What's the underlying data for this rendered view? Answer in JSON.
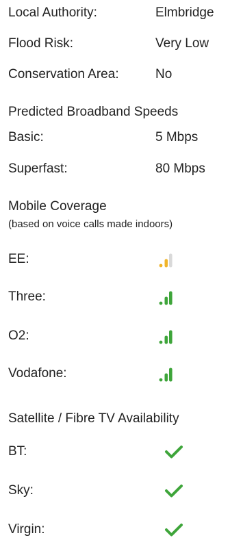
{
  "property": {
    "local_authority": {
      "label": "Local Authority:",
      "value": "Elmbridge"
    },
    "flood_risk": {
      "label": "Flood Risk:",
      "value": "Very Low"
    },
    "conservation_area": {
      "label": "Conservation Area:",
      "value": "No"
    }
  },
  "broadband": {
    "title": "Predicted Broadband Speeds",
    "basic": {
      "label": "Basic:",
      "value": "5 Mbps"
    },
    "superfast": {
      "label": "Superfast:",
      "value": "80 Mbps"
    }
  },
  "mobile": {
    "title": "Mobile Coverage",
    "subtitle": "(based on voice calls made indoors)",
    "networks": [
      {
        "label": "EE:",
        "signal_bars": 2,
        "max_bars": 3,
        "color": "#f0b429"
      },
      {
        "label": "Three:",
        "signal_bars": 3,
        "max_bars": 3,
        "color": "#3ea53a"
      },
      {
        "label": "O2:",
        "signal_bars": 3,
        "max_bars": 3,
        "color": "#3ea53a"
      },
      {
        "label": "Vodafone:",
        "signal_bars": 3,
        "max_bars": 3,
        "color": "#3ea53a"
      }
    ],
    "inactive_bar_color": "#d9d9d9"
  },
  "tv": {
    "title": "Satellite / Fibre TV Availability",
    "providers": [
      {
        "label": "BT:",
        "available": true,
        "icon": "checkmark-icon"
      },
      {
        "label": "Sky:",
        "available": true,
        "icon": "checkmark-icon"
      },
      {
        "label": "Virgin:",
        "available": true,
        "icon": "checkmark-icon"
      }
    ],
    "check_color": "#3ea53a"
  }
}
